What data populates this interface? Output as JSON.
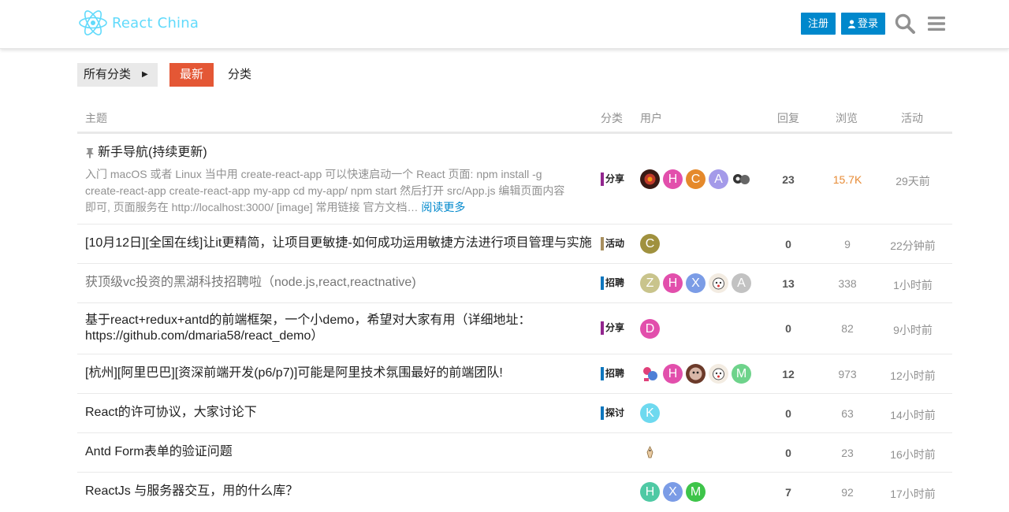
{
  "brand": {
    "name": "React China",
    "color": "#61dafb"
  },
  "header": {
    "signup_label": "注册",
    "login_label": "登录",
    "search_icon": "search-icon",
    "menu_icon": "hamburger-menu-icon"
  },
  "nav": {
    "all_categories": "所有分类",
    "latest": "最新",
    "categories": "分类"
  },
  "columns": {
    "topic": "主题",
    "category": "分类",
    "users": "用户",
    "replies": "回复",
    "views": "浏览",
    "activity": "活动"
  },
  "topics": [
    {
      "title": "新手导航(持续更新)",
      "pinned": true,
      "excerpt": "入门 macOS 或者 Linux 当中用 create-react-app 可以快速启动一个 React 页面: npm install -g create-react-app create-react-app my-app cd my-app/ npm start 然后打开 src/App.js 编辑页面内容即可, 页面服务在 http://localhost:3000/ [image] 常用链接 官方文档…",
      "read_more": "阅读更多",
      "category": "分享",
      "category_color": "#92278f",
      "avatars": [
        {
          "letter": "",
          "color": "#7a2a1a"
        },
        {
          "letter": "H",
          "color": "#e24fac"
        },
        {
          "letter": "C",
          "color": "#e5892b"
        },
        {
          "letter": "A",
          "color": "#a49ae9"
        },
        {
          "letter": "",
          "color": "#555555"
        }
      ],
      "replies": "23",
      "views": "15.7K",
      "activity": "29天前"
    },
    {
      "title": "[10月12日][全国在线]让it更精简，让项目更敏捷-如何成功运用敏捷方法进行项目管理与实施",
      "category": "活动",
      "category_color": "#a88f5e",
      "avatars": [
        {
          "letter": "C",
          "color": "#a0913e"
        }
      ],
      "replies": "0",
      "views": "9",
      "activity": "22分钟前"
    },
    {
      "title": "获顶级vc投资的黑湖科技招聘啦（node.js,react,reactnative)",
      "visited": true,
      "category": "招聘",
      "category_color": "#0e76bd",
      "avatars": [
        {
          "letter": "Z",
          "color": "#c9c48c"
        },
        {
          "letter": "H",
          "color": "#e24fac"
        },
        {
          "letter": "X",
          "color": "#7b9ce6"
        },
        {
          "letter": "",
          "color": "#f0e6d8"
        },
        {
          "letter": "A",
          "color": "#c2c2c2"
        }
      ],
      "replies": "13",
      "views": "338",
      "activity": "1小时前"
    },
    {
      "title": "基于react+redux+antd的前端框架，一个小demo，希望对大家有用（详细地址：https://github.com/dmaria58/react_demo）",
      "category": "分享",
      "category_color": "#92278f",
      "avatars": [
        {
          "letter": "D",
          "color": "#e24fac"
        }
      ],
      "replies": "0",
      "views": "82",
      "activity": "9小时前"
    },
    {
      "title": "[杭州][阿里巴巴][资深前端开发(p6/p7)]可能是阿里技术氛围最好的前端团队!",
      "category": "招聘",
      "category_color": "#0e76bd",
      "avatars": [
        {
          "letter": "",
          "color": "#4e7fd6"
        },
        {
          "letter": "H",
          "color": "#e24fac"
        },
        {
          "letter": "",
          "color": "#6b3a2a"
        },
        {
          "letter": "",
          "color": "#f0e6d8"
        },
        {
          "letter": "M",
          "color": "#6ed38b"
        }
      ],
      "replies": "12",
      "views": "973",
      "activity": "12小时前"
    },
    {
      "title": "React的许可协议，大家讨论下",
      "category": "探讨",
      "category_color": "#0e76bd",
      "avatars": [
        {
          "letter": "K",
          "color": "#6ed9ef"
        }
      ],
      "replies": "0",
      "views": "63",
      "activity": "14小时前"
    },
    {
      "title": "Antd Form表单的验证问题",
      "category": "",
      "category_color": "",
      "avatars": [
        {
          "letter": "",
          "color": "#e8d9c0"
        }
      ],
      "replies": "0",
      "views": "23",
      "activity": "16小时前"
    },
    {
      "title": "ReactJs 与服务器交互，用的什么库？",
      "category": "",
      "category_color": "",
      "avatars": [
        {
          "letter": "H",
          "color": "#4fc9a4"
        },
        {
          "letter": "X",
          "color": "#7b9ce6"
        },
        {
          "letter": "M",
          "color": "#3ec44a"
        }
      ],
      "replies": "7",
      "views": "92",
      "activity": "17小时前"
    }
  ]
}
